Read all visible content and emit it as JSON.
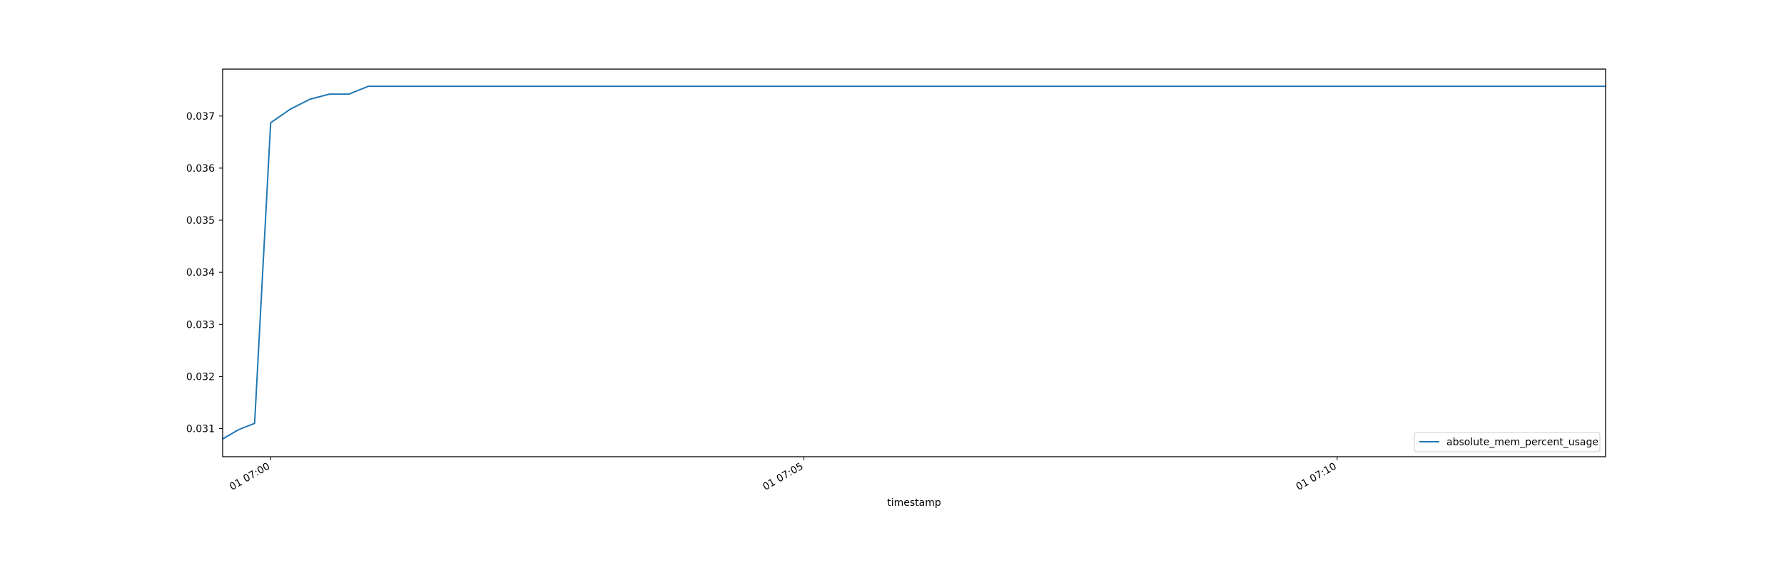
{
  "chart_data": {
    "type": "line",
    "title": "",
    "xlabel": "timestamp",
    "ylabel": "",
    "x_ticks": [
      "01 07:00",
      "01 07:05",
      "01 07:10"
    ],
    "y_ticks": [
      "0.031",
      "0.032",
      "0.033",
      "0.034",
      "0.035",
      "0.036",
      "0.037"
    ],
    "xlim": [
      "2024-01-01T06:59:33",
      "2024-01-01T07:12:31"
    ],
    "ylim": [
      0.03046,
      0.0379
    ],
    "grid": false,
    "legend_position": "lower right",
    "series": [
      {
        "name": "absolute_mem_percent_usage",
        "color": "#1f77b4",
        "x": [
          "2024-01-01T06:59:33",
          "2024-01-01T06:59:42",
          "2024-01-01T06:59:51",
          "2024-01-01T07:00:00",
          "2024-01-01T07:00:11",
          "2024-01-01T07:00:22",
          "2024-01-01T07:00:33",
          "2024-01-01T07:00:44",
          "2024-01-01T07:00:55",
          "2024-01-01T07:01:15",
          "2024-01-01T07:12:31"
        ],
        "y": [
          0.0308,
          0.03098,
          0.0311,
          0.03687,
          0.03713,
          0.03732,
          0.03742,
          0.03742,
          0.03757,
          0.03757,
          0.03757
        ]
      }
    ]
  }
}
